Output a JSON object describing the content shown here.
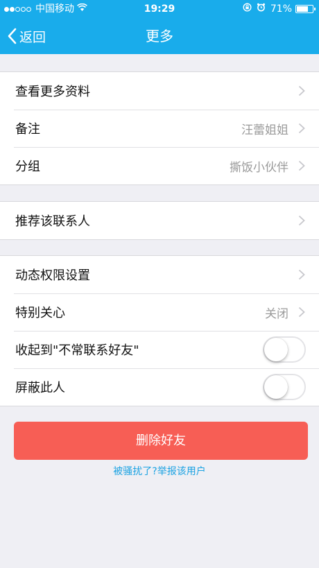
{
  "status_bar": {
    "carrier": "中国移动",
    "time": "19:29",
    "battery": "71%",
    "battery_level": 0.71
  },
  "nav": {
    "back_label": "返回",
    "title": "更多"
  },
  "groups": [
    {
      "rows": [
        {
          "label": "查看更多资料",
          "value": ""
        },
        {
          "label": "备注",
          "value": "汪蕾姐姐"
        },
        {
          "label": "分组",
          "value": "撕饭小伙伴"
        }
      ]
    },
    {
      "rows": [
        {
          "label": "推荐该联系人",
          "value": ""
        }
      ]
    },
    {
      "rows": [
        {
          "label": "动态权限设置",
          "value": ""
        },
        {
          "label": "特别关心",
          "value": "关闭"
        },
        {
          "label": "收起到\"不常联系好友\"",
          "toggle": false
        },
        {
          "label": "屏蔽此人",
          "toggle": false
        }
      ]
    }
  ],
  "delete_button": "删除好友",
  "report_link": "被骚扰了?举报该用户",
  "colors": {
    "nav_bar": "#19aceb",
    "delete_button": "#f75e55",
    "link": "#1aa2e2",
    "background": "#efeff4"
  }
}
